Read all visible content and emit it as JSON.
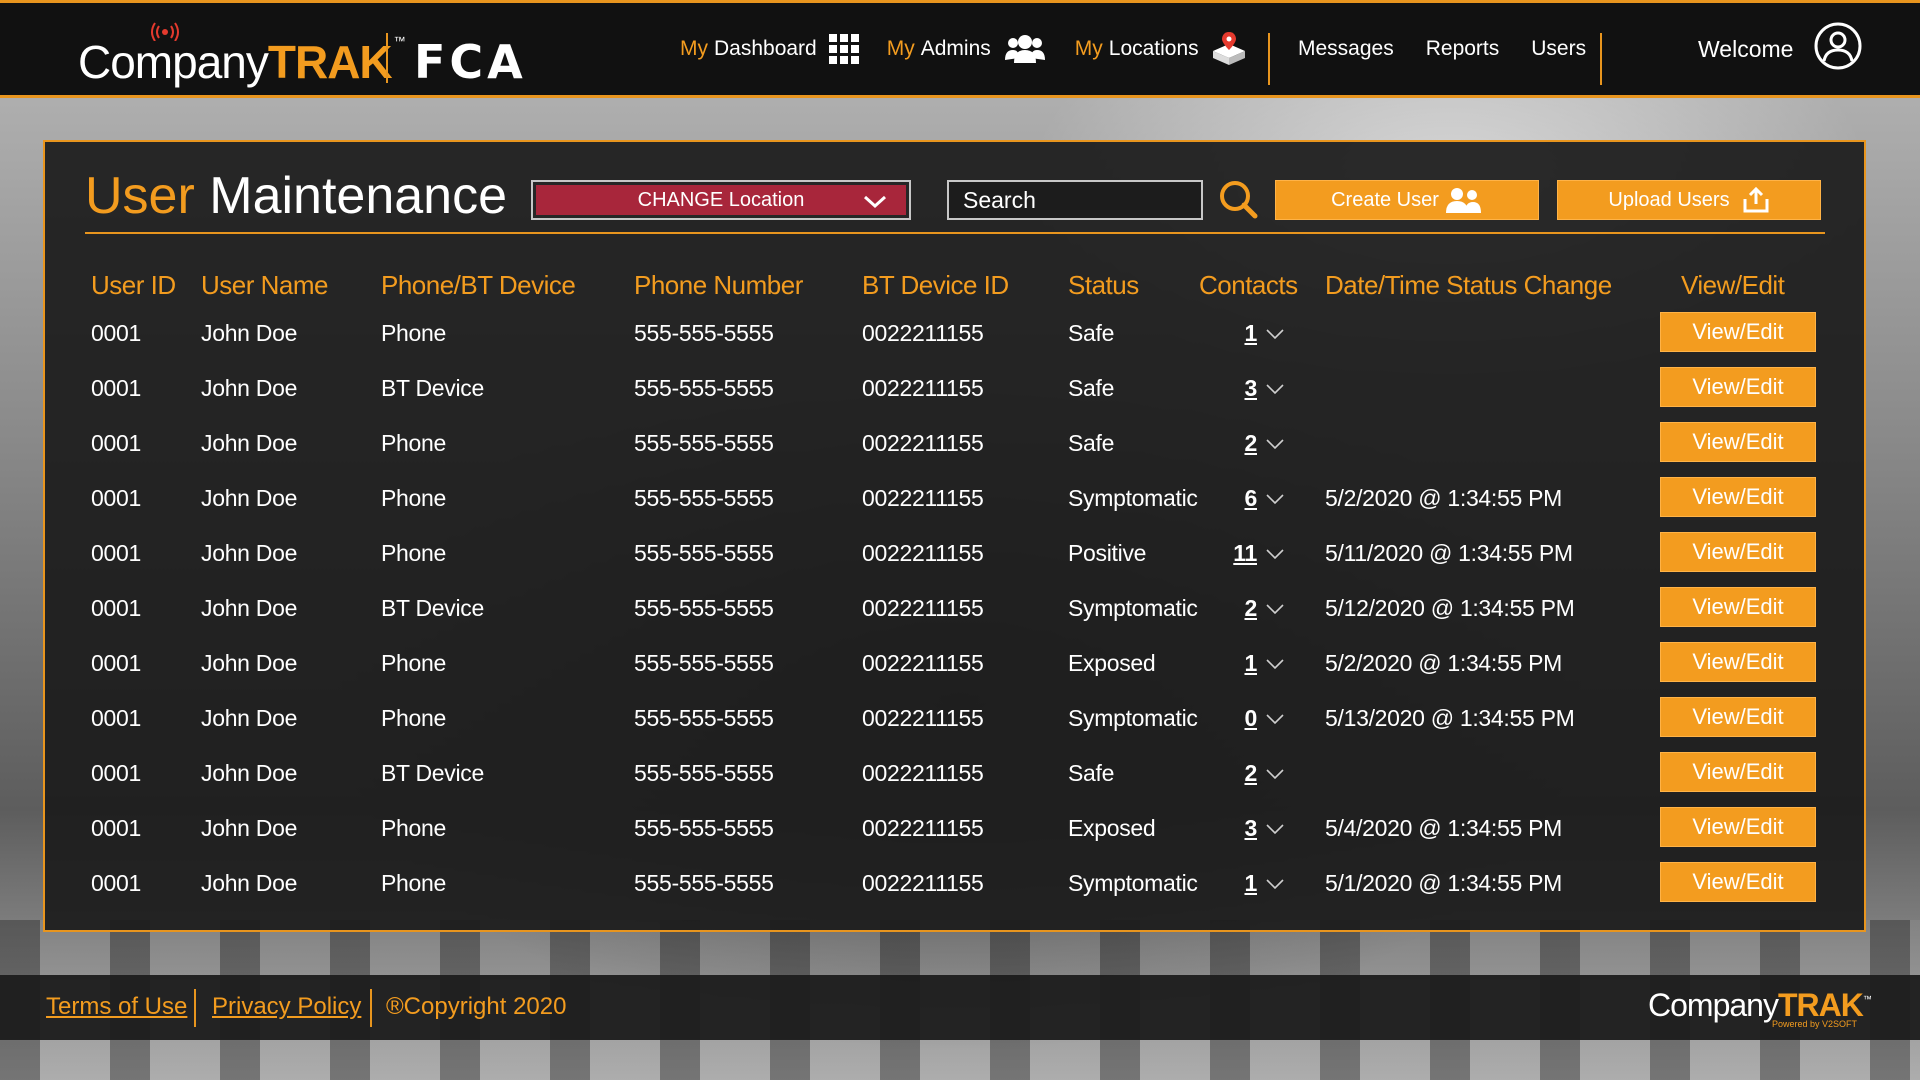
{
  "brand": {
    "company": "Company",
    "trak": "TRAK",
    "tm": "™",
    "partner": "FCA",
    "powered_by": "Powered by V2SOFT"
  },
  "nav": {
    "dashboard": {
      "prefix": "My",
      "label": "Dashboard",
      "icon": "grid-icon"
    },
    "admins": {
      "prefix": "My",
      "label": "Admins",
      "icon": "users-group-icon"
    },
    "locations": {
      "prefix": "My",
      "label": "Locations",
      "icon": "location-box-icon"
    },
    "messages": "Messages",
    "reports": "Reports",
    "users": "Users",
    "welcome": "Welcome"
  },
  "page": {
    "title_first": "User",
    "title_second": "Maintenance",
    "change_location": "CHANGE Location",
    "search_placeholder": "Search",
    "create_user": "Create User",
    "upload_users": "Upload Users"
  },
  "table": {
    "headers": {
      "user_id": "User ID",
      "user_name": "User Name",
      "device": "Phone/BT Device",
      "phone": "Phone Number",
      "bt_id": "BT Device ID",
      "status": "Status",
      "contacts": "Contacts",
      "date": "Date/Time Status Change",
      "view_edit": "View/Edit"
    },
    "view_edit_label": "View/Edit",
    "rows": [
      {
        "id": "0001",
        "name": "John Doe",
        "device": "Phone",
        "phone": "555-555-5555",
        "bt": "0022211155",
        "status": "Safe",
        "contacts": "1",
        "date": ""
      },
      {
        "id": "0001",
        "name": "John Doe",
        "device": "BT Device",
        "phone": "555-555-5555",
        "bt": "0022211155",
        "status": "Safe",
        "contacts": "3",
        "date": ""
      },
      {
        "id": "0001",
        "name": "John Doe",
        "device": "Phone",
        "phone": "555-555-5555",
        "bt": "0022211155",
        "status": "Safe",
        "contacts": "2",
        "date": ""
      },
      {
        "id": "0001",
        "name": "John Doe",
        "device": "Phone",
        "phone": "555-555-5555",
        "bt": "0022211155",
        "status": "Symptomatic",
        "contacts": "6",
        "date": "5/2/2020  @ 1:34:55 PM"
      },
      {
        "id": "0001",
        "name": "John Doe",
        "device": "Phone",
        "phone": "555-555-5555",
        "bt": "0022211155",
        "status": "Positive",
        "contacts": "11",
        "date": "5/11/2020  @ 1:34:55 PM"
      },
      {
        "id": "0001",
        "name": "John Doe",
        "device": "BT Device",
        "phone": "555-555-5555",
        "bt": "0022211155",
        "status": "Symptomatic",
        "contacts": "2",
        "date": "5/12/2020  @ 1:34:55 PM"
      },
      {
        "id": "0001",
        "name": "John Doe",
        "device": "Phone",
        "phone": "555-555-5555",
        "bt": "0022211155",
        "status": "Exposed",
        "contacts": "1",
        "date": "5/2/2020  @ 1:34:55 PM"
      },
      {
        "id": "0001",
        "name": "John Doe",
        "device": "Phone",
        "phone": "555-555-5555",
        "bt": "0022211155",
        "status": "Symptomatic",
        "contacts": "0",
        "date": "5/13/2020  @ 1:34:55 PM"
      },
      {
        "id": "0001",
        "name": "John Doe",
        "device": "BT Device",
        "phone": "555-555-5555",
        "bt": "0022211155",
        "status": "Safe",
        "contacts": "2",
        "date": ""
      },
      {
        "id": "0001",
        "name": "John Doe",
        "device": "Phone",
        "phone": "555-555-5555",
        "bt": "0022211155",
        "status": "Exposed",
        "contacts": "3",
        "date": "5/4/2020  @ 1:34:55 PM"
      },
      {
        "id": "0001",
        "name": "John Doe",
        "device": "Phone",
        "phone": "555-555-5555",
        "bt": "0022211155",
        "status": "Symptomatic",
        "contacts": "1",
        "date": "5/1/2020  @ 1:34:55 PM"
      }
    ]
  },
  "footer": {
    "terms": "Terms of Use",
    "privacy": "Privacy Policy",
    "copyright": "®Copyright 2020"
  },
  "colors": {
    "accent": "#f39c1f",
    "location_button": "#a8263b",
    "panel": "#1c1c1c"
  }
}
